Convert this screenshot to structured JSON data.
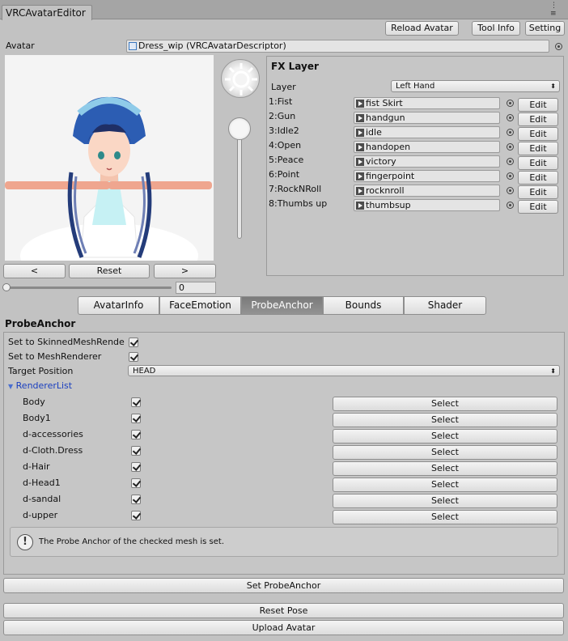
{
  "window": {
    "tab_title": "VRCAvatarEditor"
  },
  "toolbar": {
    "reload_label": "Reload Avatar",
    "toolinfo_label": "Tool Info",
    "setting_label": "Setting"
  },
  "avatar": {
    "label": "Avatar",
    "field_value": "Dress_wip (VRCAvatarDescriptor)"
  },
  "preview": {
    "prev_label": "<",
    "reset_label": "Reset",
    "next_label": ">",
    "slider_value": "0",
    "slider_fraction": 0
  },
  "fx": {
    "title": "FX Layer",
    "layer_label": "Layer",
    "layer_value": "Left Hand",
    "edit_label": "Edit",
    "rows": [
      {
        "label": "1:Fist",
        "clip": "fist Skirt"
      },
      {
        "label": "2:Gun",
        "clip": "handgun"
      },
      {
        "label": "3:Idle2",
        "clip": "idle"
      },
      {
        "label": "4:Open",
        "clip": "handopen"
      },
      {
        "label": "5:Peace",
        "clip": "victory"
      },
      {
        "label": "6:Point",
        "clip": "fingerpoint"
      },
      {
        "label": "7:RockNRoll",
        "clip": "rocknroll"
      },
      {
        "label": "8:Thumbs up",
        "clip": "thumbsup"
      }
    ]
  },
  "tabs": [
    "AvatarInfo",
    "FaceEmotion",
    "ProbeAnchor",
    "Bounds",
    "Shader"
  ],
  "active_tab": "ProbeAnchor",
  "probe": {
    "heading": "ProbeAnchor",
    "skinned_label": "Set to SkinnedMeshRende",
    "mesh_label": "Set to MeshRenderer",
    "target_label": "Target Position",
    "target_value": "HEAD",
    "renderer_list_label": "RendererList",
    "select_label": "Select",
    "renderers": [
      "Body",
      "Body1",
      "d-accessories",
      "d-Cloth.Dress",
      "d-Hair",
      "d-Head1",
      "d-sandal",
      "d-upper"
    ],
    "info_text": "The Probe Anchor of the checked mesh is set."
  },
  "bottom": {
    "set_probe_label": "Set ProbeAnchor",
    "reset_pose_label": "Reset Pose",
    "upload_label": "Upload Avatar"
  },
  "colors": {
    "panel_bg": "#c2c2c2",
    "active_tab": "#828282",
    "link_blue": "#1a3fbf"
  }
}
